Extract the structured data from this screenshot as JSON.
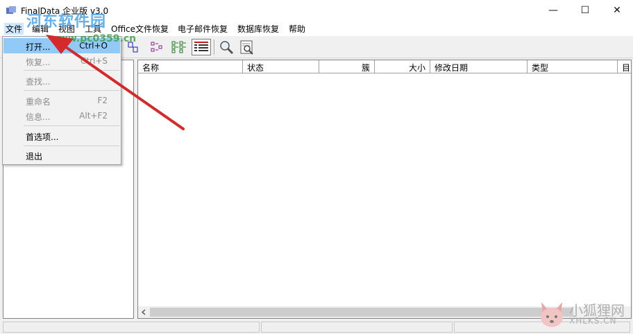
{
  "window": {
    "title": "FinalData 企业版 v3.0",
    "minimize": "—",
    "maximize": "☐",
    "close": "✕"
  },
  "menubar": {
    "items": [
      "文件",
      "编辑",
      "视图",
      "工具",
      "Office文件恢复",
      "电子邮件恢复",
      "数据库恢复",
      "帮助"
    ]
  },
  "file_menu": {
    "items": [
      {
        "label": "打开...",
        "shortcut": "Ctrl+O"
      },
      {
        "label": "恢复...",
        "shortcut": "Ctrl+S"
      },
      {
        "label": "查找...",
        "shortcut": ""
      },
      {
        "label": "重命名",
        "shortcut": "F2"
      },
      {
        "label": "信息...",
        "shortcut": "Alt+F2"
      },
      {
        "label": "首选项...",
        "shortcut": ""
      },
      {
        "label": "退出",
        "shortcut": ""
      }
    ]
  },
  "file_list": {
    "columns": [
      "名称",
      "状态",
      "簇",
      "大小",
      "修改日期",
      "类型",
      "目"
    ]
  },
  "watermarks": {
    "site_cn": "河东软件园",
    "site_url": "www.pc0359.cn",
    "brand_cn": "小狐狸网",
    "brand_url": "XHLKS.CN"
  },
  "colors": {
    "menu_highlight": "#91c9f7",
    "arrow": "#d42a2a"
  }
}
